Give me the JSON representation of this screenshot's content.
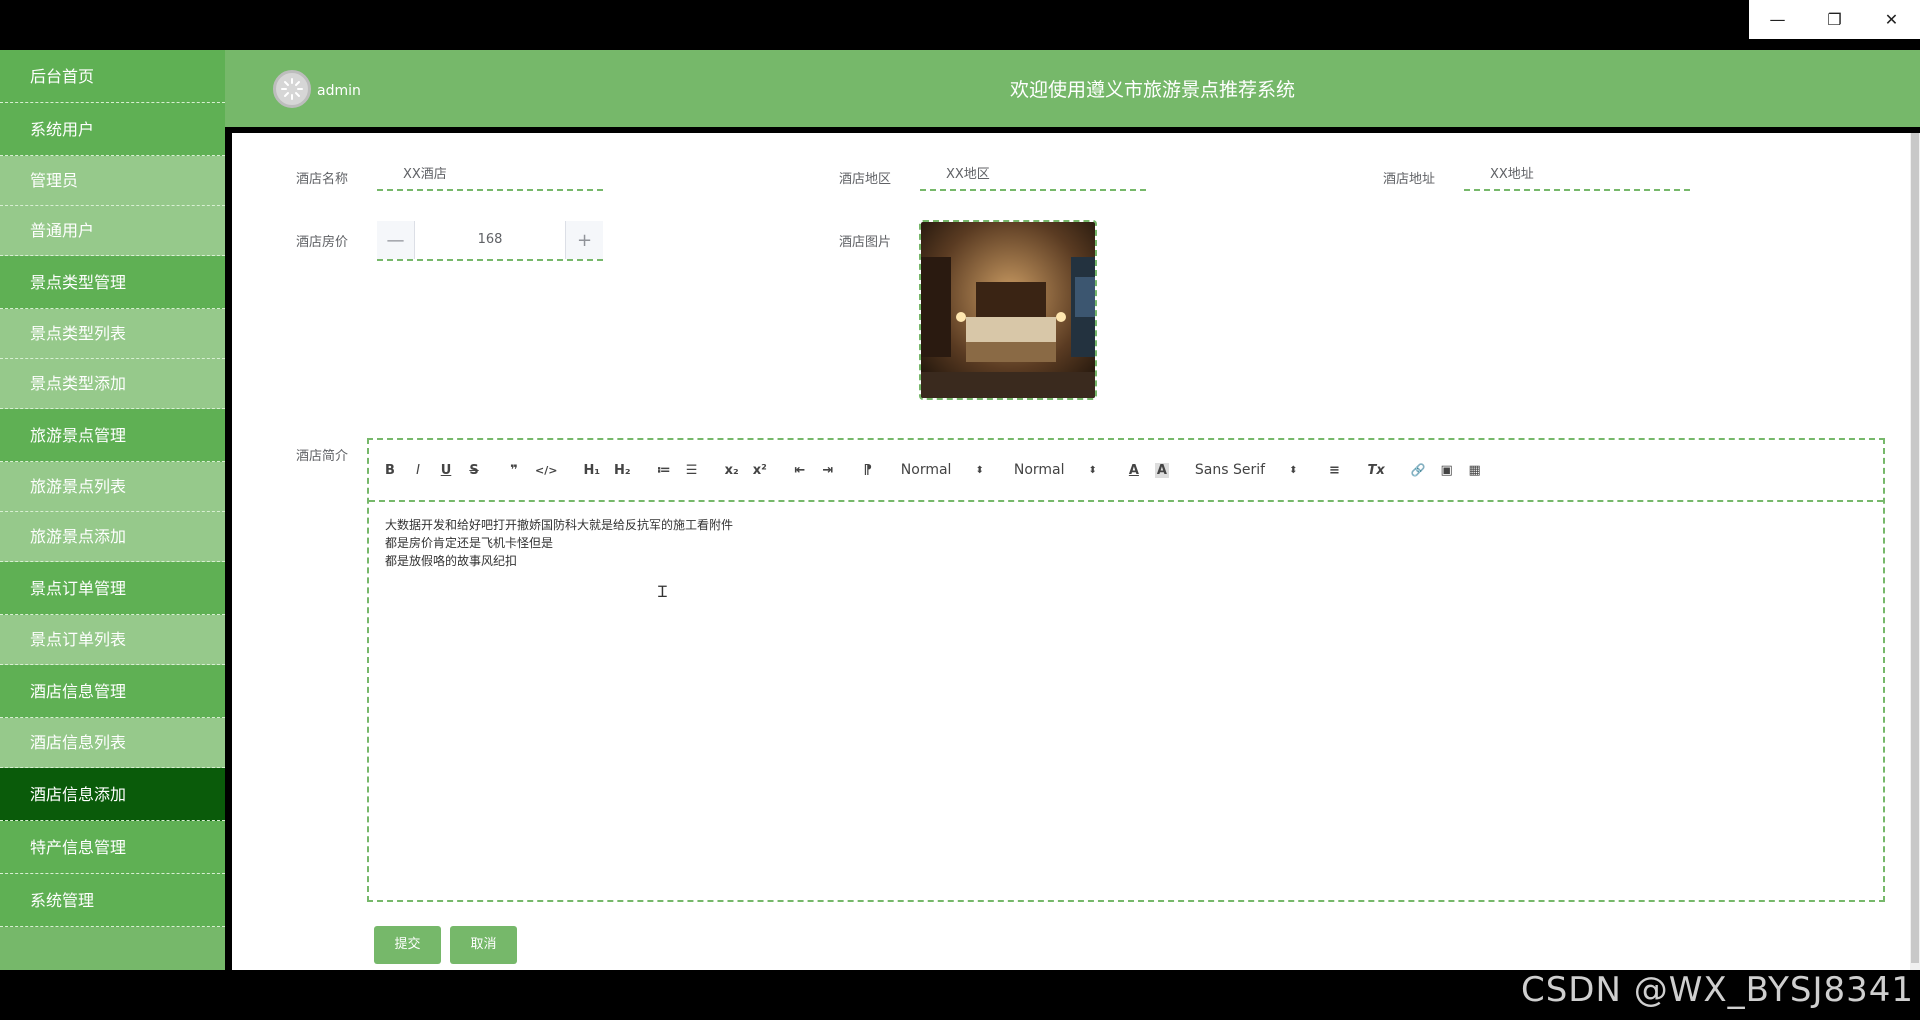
{
  "window": {
    "minimize": "—",
    "restore": "❐",
    "close": "✕"
  },
  "sidebar": {
    "items": [
      {
        "label": "后台首页",
        "kind": "group"
      },
      {
        "label": "系统用户",
        "kind": "group"
      },
      {
        "label": "管理员",
        "kind": "sub"
      },
      {
        "label": "普通用户",
        "kind": "sub"
      },
      {
        "label": "景点类型管理",
        "kind": "group"
      },
      {
        "label": "景点类型列表",
        "kind": "sub"
      },
      {
        "label": "景点类型添加",
        "kind": "sub"
      },
      {
        "label": "旅游景点管理",
        "kind": "group"
      },
      {
        "label": "旅游景点列表",
        "kind": "sub"
      },
      {
        "label": "旅游景点添加",
        "kind": "sub"
      },
      {
        "label": "景点订单管理",
        "kind": "group"
      },
      {
        "label": "景点订单列表",
        "kind": "sub"
      },
      {
        "label": "酒店信息管理",
        "kind": "group"
      },
      {
        "label": "酒店信息列表",
        "kind": "sub"
      },
      {
        "label": "酒店信息添加",
        "kind": "active"
      },
      {
        "label": "特产信息管理",
        "kind": "group"
      },
      {
        "label": "系统管理",
        "kind": "group"
      }
    ]
  },
  "header": {
    "username": "admin",
    "title": "欢迎使用遵义市旅游景点推荐系统"
  },
  "form": {
    "name_label": "酒店名称",
    "name_value": "XX酒店",
    "region_label": "酒店地区",
    "region_value": "XX地区",
    "address_label": "酒店地址",
    "address_value": "XX地址",
    "price_label": "酒店房价",
    "price_value": "168",
    "price_minus": "—",
    "price_plus": "+",
    "image_label": "酒店图片",
    "intro_label": "酒店简介"
  },
  "editor": {
    "toolbar": {
      "bold": "B",
      "italic": "I",
      "underline": "U",
      "strike": "S",
      "blockquote": "❞",
      "code": "</>",
      "h1": "H₁",
      "h2": "H₂",
      "ordered": "≔",
      "bullet": "☰",
      "sub": "x₂",
      "sup": "x²",
      "outdent": "⇤",
      "indent": "⇥",
      "direction": "⁋",
      "size_select": "Normal",
      "header_select": "Normal",
      "color": "A",
      "background": "A",
      "font_select": "Sans Serif",
      "align": "≡",
      "clean": "Tx",
      "link": "🔗",
      "image": "▣",
      "video": "▦"
    },
    "lines": [
      "大数据开发和给好吧打开撤娇国防科大就是给反抗军的施工看附件",
      "都是房价肯定还是飞机卡怪但是",
      "都是放假咯的故事风纪扣"
    ]
  },
  "buttons": {
    "submit": "提交",
    "cancel": "取消"
  },
  "watermark": "CSDN @WX_BYSJ8341",
  "colors": {
    "primary": "#76b86a",
    "active": "#0a5b0a",
    "sub": "#96c98b"
  }
}
